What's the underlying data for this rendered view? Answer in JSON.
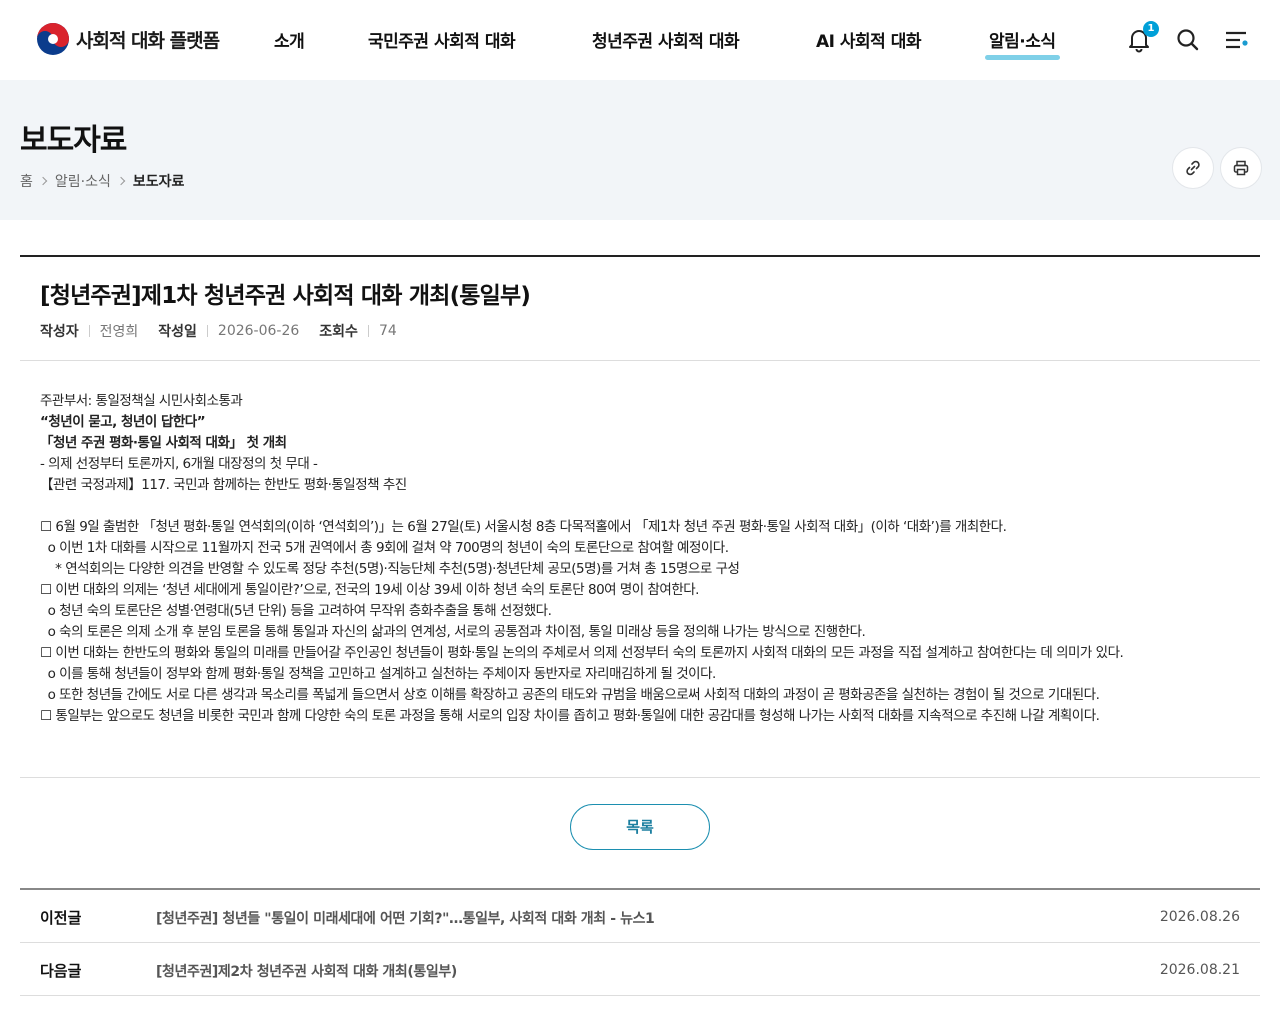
{
  "header": {
    "logo_text": "사회적 대화 플랫폼",
    "nav": [
      "소개",
      "국민주권 사회적 대화",
      "청년주권 사회적 대화",
      "AI 사회적 대화",
      "알림·소식"
    ],
    "notification_count": "1",
    "accent_color": "#7fd0e8"
  },
  "page": {
    "title": "보도자료",
    "breadcrumb": [
      "홈",
      "알림·소식",
      "보도자료"
    ]
  },
  "article": {
    "title": "[청년주권]제1차 청년주권 사회적 대화 개최(통일부)",
    "meta": {
      "author_label": "작성자",
      "author": "전영희",
      "date_label": "작성일",
      "date": "2026-06-26",
      "views_label": "조회수",
      "views": "74"
    },
    "body": [
      {
        "text": "주관부서: 통일정책실 시민사회소통과",
        "bold": false
      },
      {
        "text": "“청년이 묻고, 청년이 답한다”",
        "bold": true
      },
      {
        "text": "「청년 주권 평화·통일 사회적 대화」 첫 개최",
        "bold": true
      },
      {
        "text": "- 의제 선정부터 토론까지, 6개월 대장정의 첫 무대 -",
        "bold": false
      },
      {
        "text": "【관련 국정과제】117. 국민과 함께하는 한반도 평화·통일정책 추진",
        "bold": false
      },
      {
        "text": " ",
        "bold": false
      },
      {
        "text": "☐ 6월 9일 출범한 「청년 평화·통일 연석회의(이하 ‘연석회의’)」는 6월 27일(토) 서울시청 8층 다목적홀에서 「제1차 청년 주권 평화·통일 사회적 대화」(이하 ‘대화’)를 개최한다.",
        "bold": false
      },
      {
        "text": "  o 이번 1차 대화를 시작으로 11월까지 전국 5개 권역에서 총 9회에 걸쳐 약 700명의 청년이 숙의 토론단으로 참여할 예정이다.",
        "bold": false
      },
      {
        "text": "    * 연석회의는 다양한 의견을 반영할 수 있도록 정당 추천(5명)·직능단체 추천(5명)·청년단체 공모(5명)를 거쳐 총 15명으로 구성",
        "bold": false
      },
      {
        "text": "☐ 이번 대화의 의제는 ‘청년 세대에게 통일이란?’으로, 전국의 19세 이상 39세 이하 청년 숙의 토론단 80여 명이 참여한다.",
        "bold": false
      },
      {
        "text": "  o 청년 숙의 토론단은 성별·연령대(5년 단위) 등을 고려하여 무작위 층화추출을 통해 선정했다.",
        "bold": false
      },
      {
        "text": "  o 숙의 토론은 의제 소개 후 분임 토론을 통해 통일과 자신의 삶과의 연계성, 서로의 공통점과 차이점, 통일 미래상 등을 정의해 나가는 방식으로 진행한다.",
        "bold": false
      },
      {
        "text": "☐ 이번 대화는 한반도의 평화와 통일의 미래를 만들어갈 주인공인 청년들이 평화·통일 논의의 주체로서 의제 선정부터 숙의 토론까지 사회적 대화의 모든 과정을 직접 설계하고 참여한다는 데 의미가 있다.",
        "bold": false
      },
      {
        "text": "  o 이를 통해 청년들이 정부와 함께 평화·통일 정책을 고민하고 설계하고 실천하는 주체이자 동반자로 자리매김하게 될 것이다.",
        "bold": false
      },
      {
        "text": "  o 또한 청년들 간에도 서로 다른 생각과 목소리를 폭넓게 들으면서 상호 이해를 확장하고 공존의 태도와 규범을 배움으로써 사회적 대화의 과정이 곧 평화공존을 실천하는 경험이 될 것으로 기대된다.",
        "bold": false
      },
      {
        "text": "☐ 통일부는 앞으로도 청년을 비롯한 국민과 함께 다양한 숙의 토론 과정을 통해 서로의 입장 차이를 좁히고 평화·통일에 대한 공감대를 형성해 나가는 사회적 대화를 지속적으로 추진해 나갈 계획이다.",
        "bold": false
      }
    ]
  },
  "list_button": "목록",
  "prev": {
    "label": "이전글",
    "title": "[청년주권] 청년들 \"통일이 미래세대에 어떤 기회?\"…통일부, 사회적 대화 개최 - 뉴스1",
    "date": "2026.08.26"
  },
  "next": {
    "label": "다음글",
    "title": "[청년주권]제2차 청년주권 사회적 대화 개최(통일부)",
    "date": "2026.08.21"
  }
}
